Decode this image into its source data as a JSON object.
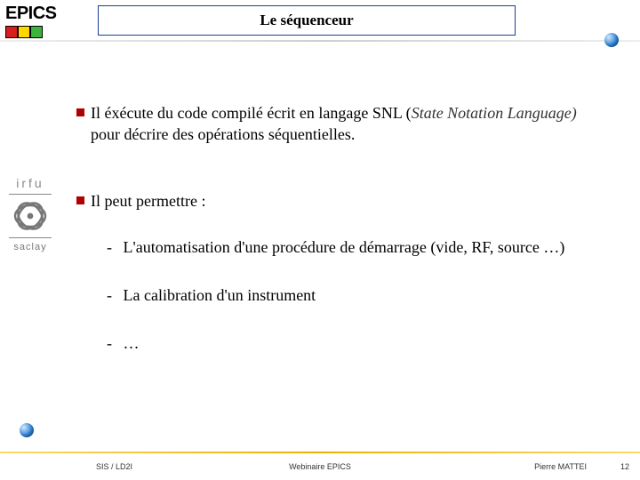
{
  "logo": {
    "text": "EPICS"
  },
  "title": "Le séquenceur",
  "side": {
    "irfu": "irfu",
    "saclay": "saclay"
  },
  "content": {
    "bullet1_pre": "Il éxécute du code compilé écrit en langage SNL (",
    "bullet1_it": "State Notation Language)",
    "bullet1_post": " pour décrire des opérations séquentielles.",
    "bullet2": "Il peut permettre  :",
    "sub1": "L'automatisation d'une procédure de démarrage (vide, RF, source …)",
    "sub2": "La calibration d'un instrument",
    "sub3": "…"
  },
  "footer": {
    "left": "SIS / LD2I",
    "center": "Webinaire EPICS",
    "right": "Pierre MATTEI",
    "num": "12"
  }
}
